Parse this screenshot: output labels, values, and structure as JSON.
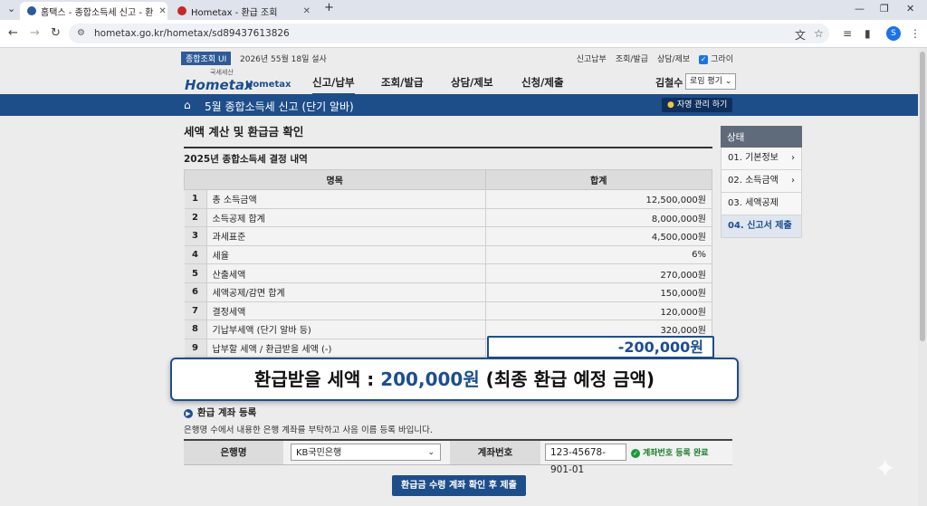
{
  "browser": {
    "tabs": [
      {
        "title": "홈택스 - 종합소득세 신고 - 환",
        "active": true
      },
      {
        "title": "Hometax - 환급 조회",
        "active": false
      }
    ],
    "new_tab_label": "+",
    "url": "hometax.go.kr/hometax/sd89437613826",
    "profile_initial": "S"
  },
  "util": {
    "badge": "종합조회 UI",
    "date": "2026년 55월 18일 설사",
    "links": [
      "신고납부",
      "조회/발급",
      "상담/제보"
    ],
    "checkbox_label": "그라이"
  },
  "logo": {
    "top": "국세세산",
    "main": "Hometax",
    "sub": "Hometax"
  },
  "gnb": [
    "신고/납부",
    "조회/발급",
    "상담/제보",
    "신청/제출"
  ],
  "user": {
    "name": "김철수",
    "logout": "로임 평기"
  },
  "titlebar": {
    "title": "5월 종합소득세 신고 (단기 알바)",
    "helper": "자영 관리 하기"
  },
  "main": {
    "heading": "세액 계산 및 환급금 확인",
    "subheading": "2025년 종합소득세 결정 내역",
    "table": {
      "headers": [
        "명목",
        "합계"
      ],
      "rows": [
        {
          "no": "1",
          "name": "총 소득금액",
          "amount": "12,500,000원"
        },
        {
          "no": "2",
          "name": "소득공제 합계",
          "amount": "8,000,000원"
        },
        {
          "no": "3",
          "name": "과세표준",
          "amount": "4,500,000원"
        },
        {
          "no": "4",
          "name": "세율",
          "amount": "6%"
        },
        {
          "no": "5",
          "name": "산출세액",
          "amount": "270,000원"
        },
        {
          "no": "6",
          "name": "세액공제/감면 합계",
          "amount": "150,000원"
        },
        {
          "no": "7",
          "name": "결정세액",
          "amount": "120,000원"
        },
        {
          "no": "8",
          "name": "기납부세액 (단기 알바 등)",
          "amount": "320,000원"
        },
        {
          "no": "9",
          "name": "납부할 세액 / 환급받을 세액 (-)",
          "amount": "-200,000원"
        }
      ]
    }
  },
  "sidebar": {
    "heading": "상태",
    "items": [
      {
        "label": "01. 기본정보",
        "chevron": "›"
      },
      {
        "label": "02. 소득금액",
        "chevron": "›"
      },
      {
        "label": "03. 세액공제",
        "chevron": ""
      },
      {
        "label": "04. 신고서 제출",
        "chevron": ""
      }
    ]
  },
  "overlay": {
    "prefix": "환급받을 세액 : ",
    "amount": "200,000원",
    "suffix": " (최종 환급 예정 금액)"
  },
  "bank": {
    "heading": "환급 계좌 등록",
    "description": "은행명 수에서 내용한 은행 계좌를 부탁하고 사음 이름 등록 바입니다.",
    "bank_label": "은행명",
    "bank_value": "KB국민은행",
    "account_label": "계좌번호",
    "account_value": "123-45678-901-01",
    "status": "계좌번호 등록 완료"
  },
  "submit_label": "환급금 수령 계좌 확인 후 제출",
  "colors": {
    "primary": "#1e4e8a",
    "accent": "#1d4e8f",
    "success": "#1b9a3a"
  }
}
